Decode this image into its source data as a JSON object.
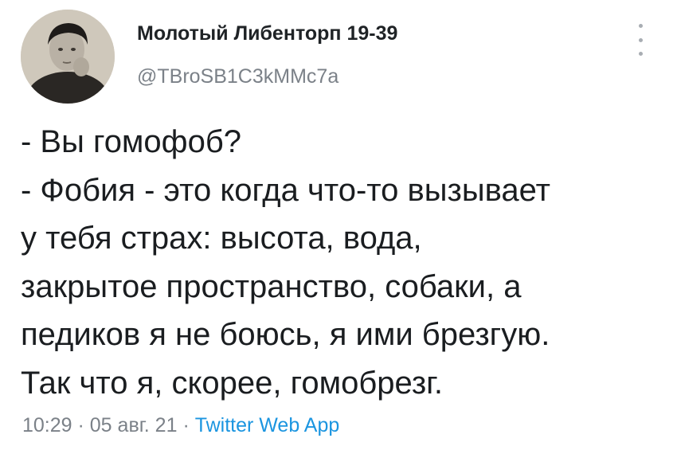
{
  "author": {
    "display_name": "Молотый Либенторп 19-39",
    "handle": "@TBroSB1C3kMMc7a"
  },
  "menu_icon": "more-vertical-icon",
  "tweet": {
    "lines": [
      "- Вы гомофоб?",
      "- Фобия - это когда что-то вызывает",
      "у тебя страх: высота, вода,",
      "закрытое пространство, собаки, а",
      "педиков я не боюсь, я ими брезгую.",
      "Так что я, скорее, гомобрезг."
    ]
  },
  "meta": {
    "time": "10:29",
    "sep1": " · ",
    "date": "05 авг. 21",
    "sep2": " · ",
    "source": "Twitter Web App"
  },
  "colors": {
    "text": "#1a1d20",
    "secondary": "#7b8188",
    "link": "#1b95e0"
  }
}
